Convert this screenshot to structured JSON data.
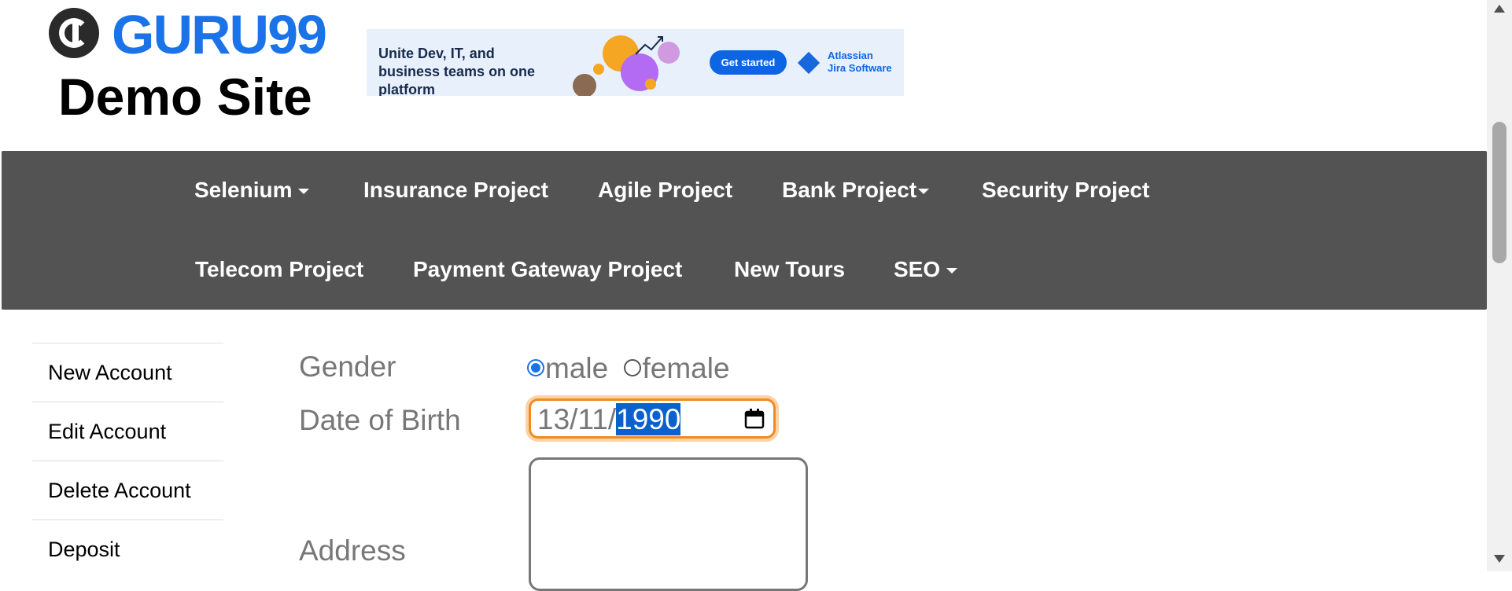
{
  "header": {
    "brand": "GURU99",
    "site_title": "Demo Site"
  },
  "banner": {
    "text": "Unite Dev, IT, and business teams on one platform",
    "cta": "Get started",
    "product_line1": "Atlassian",
    "product_line2": "Jira Software"
  },
  "nav": {
    "row1": [
      {
        "label": "Selenium",
        "dropdown": true
      },
      {
        "label": "Insurance Project",
        "dropdown": false
      },
      {
        "label": "Agile Project",
        "dropdown": false
      },
      {
        "label": "Bank Project",
        "dropdown": true
      },
      {
        "label": "Security Project",
        "dropdown": false
      }
    ],
    "row2": [
      {
        "label": "Telecom Project",
        "dropdown": false
      },
      {
        "label": "Payment Gateway Project",
        "dropdown": false
      },
      {
        "label": "New Tours",
        "dropdown": false
      },
      {
        "label": "SEO",
        "dropdown": true
      }
    ]
  },
  "sidebar": {
    "items": [
      "New Account",
      "Edit Account",
      "Delete Account",
      "Deposit"
    ]
  },
  "form": {
    "gender_label": "Gender",
    "gender_options": [
      "male",
      "female"
    ],
    "gender_selected": "male",
    "dob_label": "Date of Birth",
    "dob_day": "13",
    "dob_month": "11",
    "dob_year": "1990",
    "address_label": "Address",
    "address_value": ""
  },
  "colors": {
    "nav_bg": "#535353",
    "brand_blue": "#1a73e8",
    "focus_orange": "#f08a24",
    "label_gray": "#777777"
  }
}
